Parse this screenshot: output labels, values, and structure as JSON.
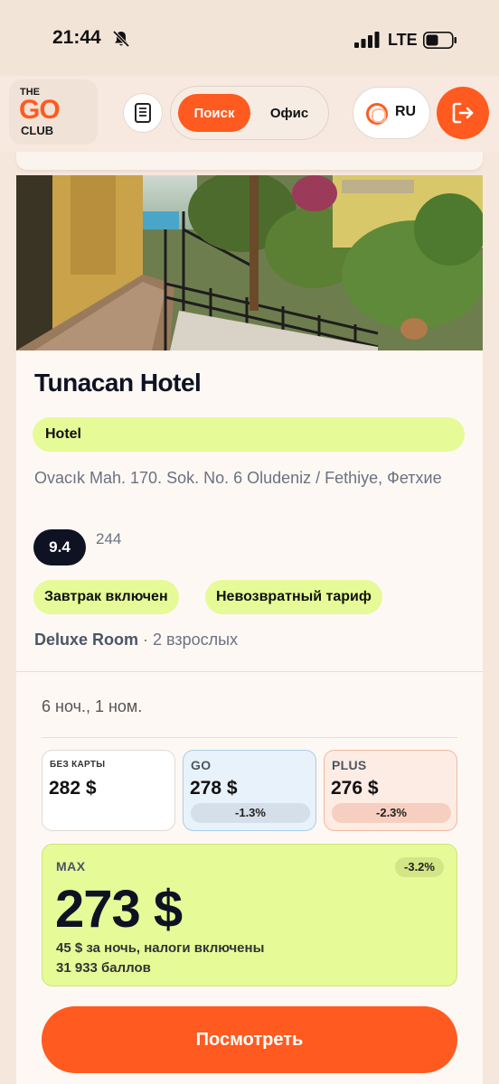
{
  "status_bar": {
    "time": "21:44",
    "network": "LTE"
  },
  "header": {
    "logo": {
      "line1": "THE",
      "line2": "GO",
      "line3": "CLUB"
    },
    "mode_toggle": {
      "active": "Поиск",
      "inactive": "Офис"
    },
    "language": "RU",
    "icons": [
      "book-icon",
      "logout-icon",
      "globe-icon"
    ]
  },
  "hotel": {
    "name": "Tunacan Hotel",
    "type": "Hotel",
    "address": "Ovacık Mah. 170. Sok. No. 6 Oludeniz / Fethiye, Фетхие",
    "rating": "9.4",
    "reviews_count": "244",
    "tags": [
      "Завтрак включен",
      "Невозвратный тариф"
    ],
    "room": "Deluxe Room",
    "guests": " · 2 взрослых"
  },
  "stay": {
    "summary": "6 ноч., 1 ном."
  },
  "prices": {
    "no_card": {
      "label": "БЕЗ КАРТЫ",
      "price": "282 $"
    },
    "go": {
      "label": "GO",
      "price": "278 $",
      "discount": "-1.3%"
    },
    "plus": {
      "label": "PLUS",
      "price": "276 $",
      "discount": "-2.3%"
    },
    "max": {
      "label": "MAX",
      "price": "273 $",
      "discount": "-3.2%",
      "per_night": "45 $ за ночь, налоги включены",
      "points": "31 933 баллов"
    }
  },
  "actions": {
    "view_label": "Посмотреть"
  },
  "colors": {
    "accent": "#ff5a1f",
    "lime": "#e6fa97",
    "dark": "#0f1222",
    "background": "#f6e7dc"
  }
}
